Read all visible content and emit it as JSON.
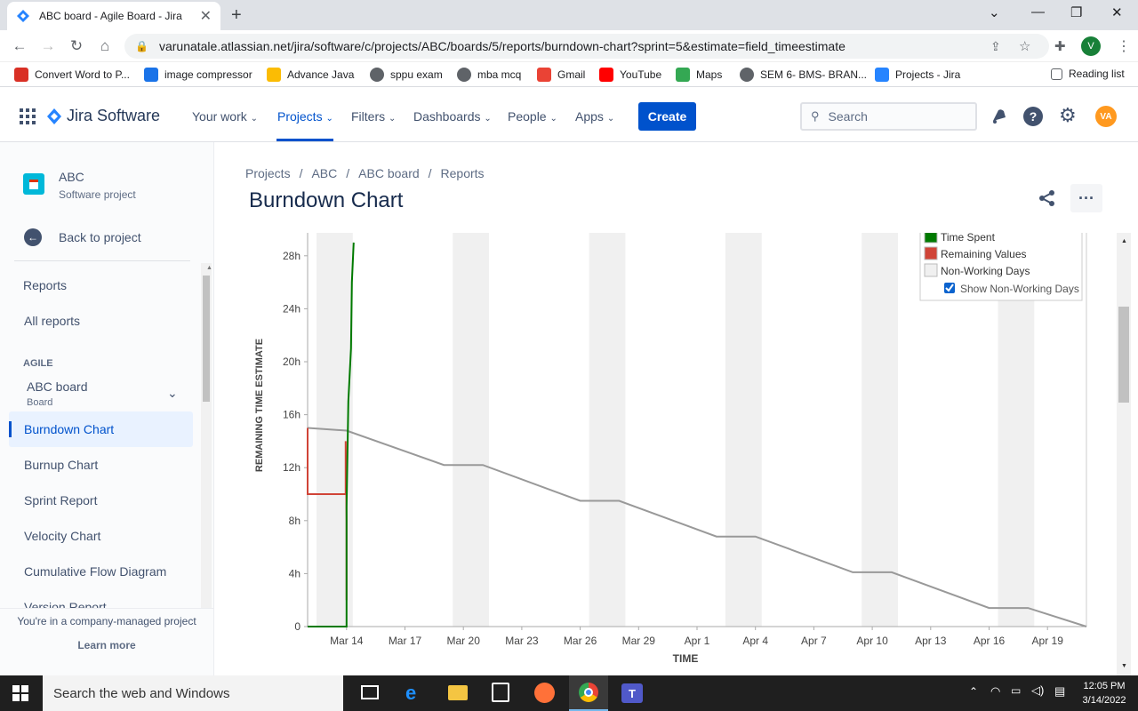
{
  "browser": {
    "tab_title": "ABC board - Agile Board - Jira",
    "url": "varunatale.atlassian.net/jira/software/c/projects/ABC/boards/5/reports/burndown-chart?sprint=5&estimate=field_timeestimate",
    "profile_initial": "V",
    "bookmarks": [
      {
        "label": "Convert Word to P...",
        "icon": "heart-icon",
        "color": "#d93025"
      },
      {
        "label": "image compressor",
        "icon": "image-icon",
        "color": "#1a73e8"
      },
      {
        "label": "Advance Java",
        "icon": "drive-icon",
        "color": "#fbbc04"
      },
      {
        "label": "sppu exam",
        "icon": "globe-icon",
        "color": "#5f6368"
      },
      {
        "label": "mba mcq",
        "icon": "globe-icon",
        "color": "#5f6368"
      },
      {
        "label": "Gmail",
        "icon": "gmail-icon",
        "color": "#ea4335"
      },
      {
        "label": "YouTube",
        "icon": "youtube-icon",
        "color": "#ff0000"
      },
      {
        "label": "Maps",
        "icon": "maps-icon",
        "color": "#34a853"
      },
      {
        "label": "SEM 6- BMS- BRAN...",
        "icon": "globe-icon",
        "color": "#5f6368"
      },
      {
        "label": "Projects - Jira",
        "icon": "jira-icon",
        "color": "#2684ff"
      }
    ],
    "reading_list": "Reading list"
  },
  "jira": {
    "product_name": "Jira Software",
    "nav": [
      "Your work",
      "Projects",
      "Filters",
      "Dashboards",
      "People",
      "Apps"
    ],
    "create_label": "Create",
    "search_placeholder": "Search",
    "avatar_initials": "VA"
  },
  "sidebar": {
    "project_name": "ABC",
    "project_type": "Software project",
    "back_label": "Back to project",
    "reports_heading": "Reports",
    "all_reports": "All reports",
    "agile_heading": "AGILE",
    "board_name": "ABC board",
    "board_type": "Board",
    "items": [
      "Burndown Chart",
      "Burnup Chart",
      "Sprint Report",
      "Velocity Chart",
      "Cumulative Flow Diagram",
      "Version Report"
    ],
    "footer_text": "You're in a company-managed project",
    "learn_more": "Learn more"
  },
  "page": {
    "breadcrumbs": [
      "Projects",
      "ABC",
      "ABC board",
      "Reports"
    ],
    "title": "Burndown Chart"
  },
  "chart_data": {
    "type": "line",
    "xlabel": "TIME",
    "ylabel": "REMAINING TIME ESTIMATE",
    "y_ticks": [
      "0",
      "4h",
      "8h",
      "12h",
      "16h",
      "20h",
      "24h",
      "28h"
    ],
    "x_ticks": [
      "Mar 14",
      "Mar 17",
      "Mar 20",
      "Mar 23",
      "Mar 26",
      "Mar 29",
      "Apr 1",
      "Apr 4",
      "Apr 7",
      "Apr 10",
      "Apr 13",
      "Apr 16",
      "Apr 19"
    ],
    "ylim_hours": [
      0,
      30
    ],
    "xlim": [
      "2022-03-12",
      "2022-04-21"
    ],
    "legend": [
      "Time Spent",
      "Remaining Values",
      "Non-Working Days",
      "Show Non-Working Days"
    ],
    "legend_placement": "top-right",
    "show_non_working_days": true,
    "non_working_days": [
      [
        "2022-03-12",
        "2022-03-14"
      ],
      [
        "2022-03-19",
        "2022-03-21"
      ],
      [
        "2022-03-26",
        "2022-03-28"
      ],
      [
        "2022-04-02",
        "2022-04-04"
      ],
      [
        "2022-04-09",
        "2022-04-11"
      ],
      [
        "2022-04-16",
        "2022-04-18"
      ]
    ],
    "series": [
      {
        "name": "Time Spent",
        "color": "#007a00",
        "points": [
          [
            "2022-03-12",
            0
          ],
          [
            "2022-03-14",
            0
          ],
          [
            "2022-03-14",
            9
          ],
          [
            "2022-03-14",
            17
          ],
          [
            "2022-03-14",
            21
          ],
          [
            "2022-03-14",
            26
          ],
          [
            "2022-03-14",
            29
          ]
        ]
      },
      {
        "name": "Remaining Values",
        "color": "#d04437",
        "points": [
          [
            "2022-03-12",
            15
          ],
          [
            "2022-03-12",
            10
          ],
          [
            "2022-03-14",
            10
          ],
          [
            "2022-03-14",
            14
          ],
          [
            "2022-03-14",
            8
          ],
          [
            "2022-03-14",
            2
          ]
        ]
      },
      {
        "color": "#999999",
        "points": [
          [
            "2022-03-12",
            15
          ],
          [
            "2022-03-14",
            14.8
          ],
          [
            "2022-03-19",
            12.2
          ],
          [
            "2022-03-21",
            12.2
          ],
          [
            "2022-03-26",
            9.5
          ],
          [
            "2022-03-28",
            9.5
          ],
          [
            "2022-04-02",
            6.8
          ],
          [
            "2022-04-04",
            6.8
          ],
          [
            "2022-04-09",
            4.1
          ],
          [
            "2022-04-11",
            4.1
          ],
          [
            "2022-04-16",
            1.4
          ],
          [
            "2022-04-18",
            1.4
          ],
          [
            "2022-04-21",
            0
          ]
        ]
      }
    ]
  },
  "taskbar": {
    "search_placeholder": "Search the web and Windows",
    "time": "12:05 PM",
    "date": "3/14/2022"
  }
}
